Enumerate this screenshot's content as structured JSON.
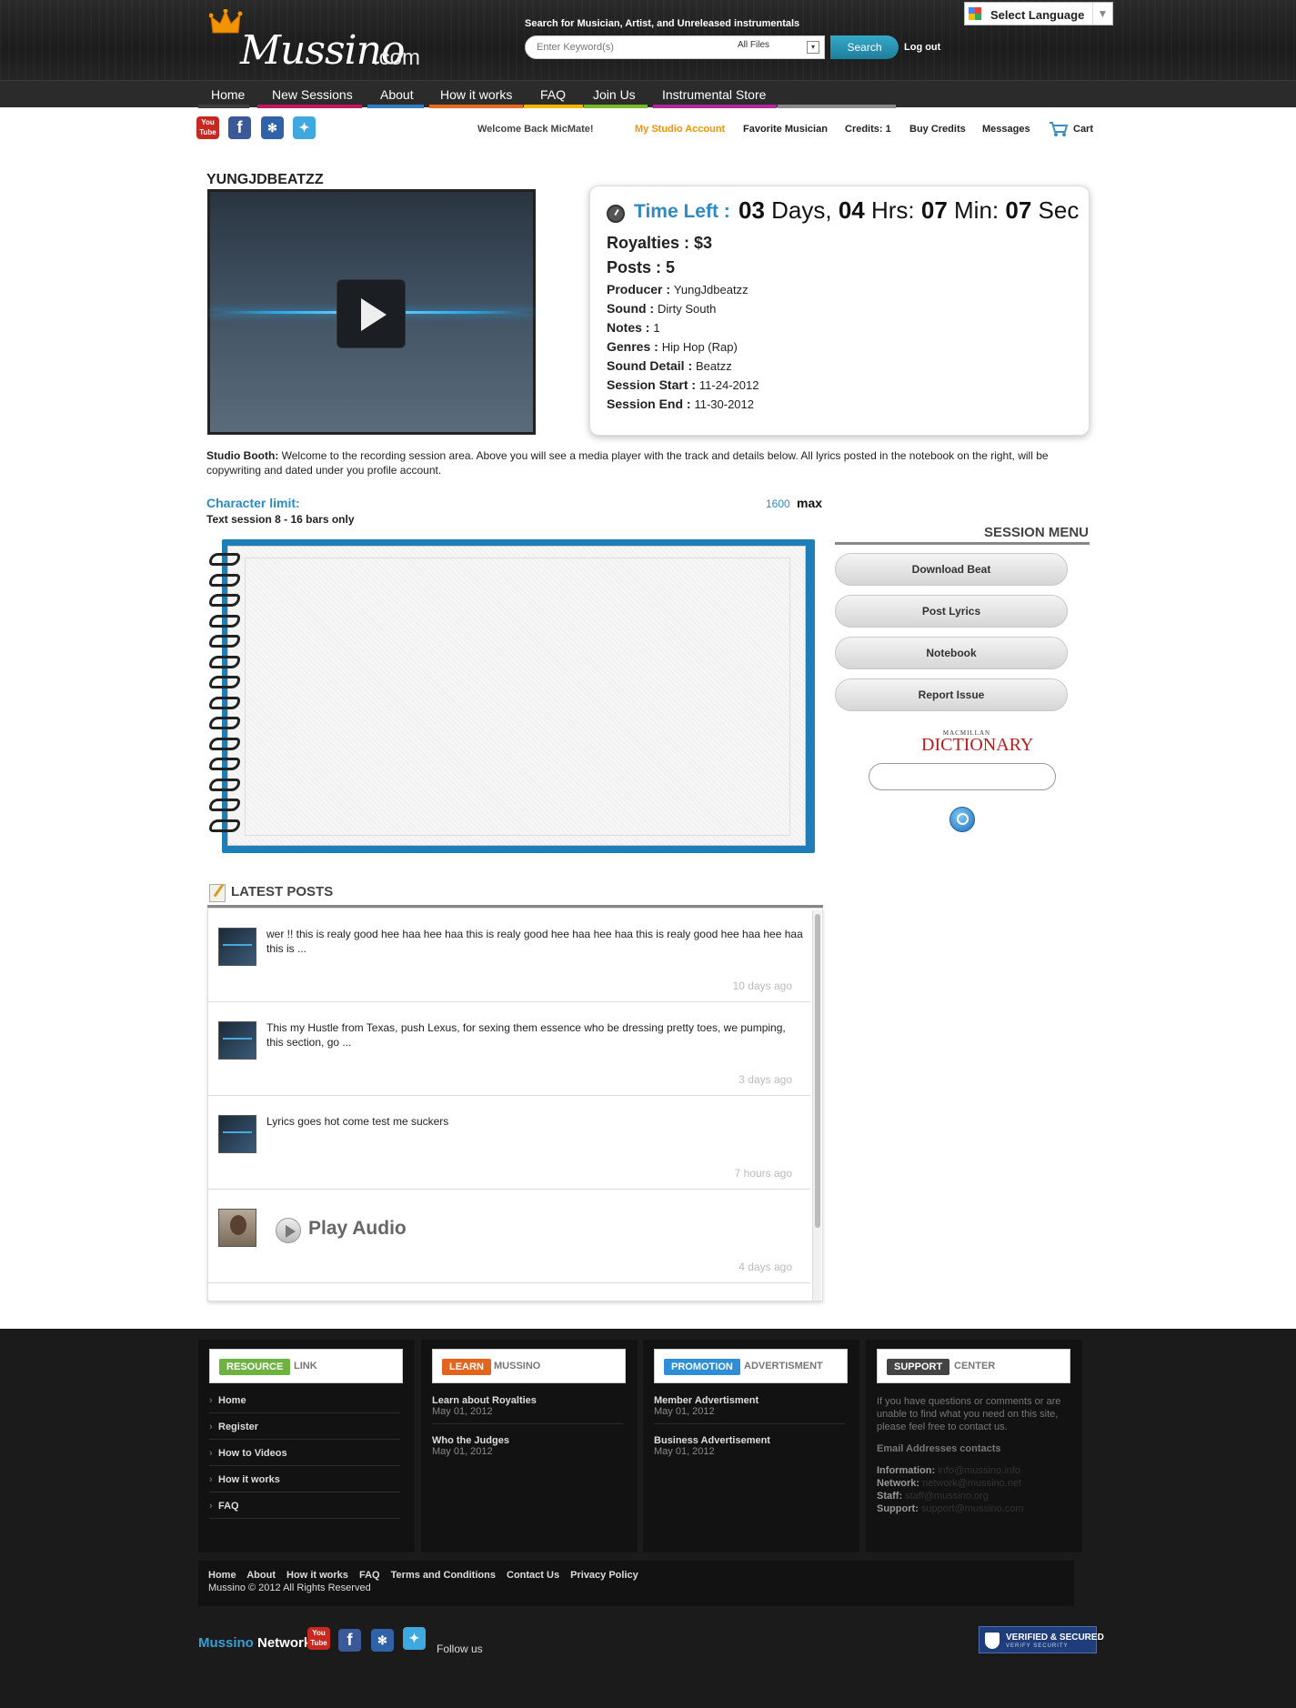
{
  "header": {
    "logo_text": "Mussino",
    "logo_domain": ".com",
    "search_caption": "Search for Musician, Artist, and Unreleased instrumentals",
    "search_placeholder": "Enter Keyword(s)",
    "search_scope": "All Files",
    "search_button": "Search",
    "logout": "Log out",
    "language_label": "Select Language"
  },
  "nav": {
    "items": [
      {
        "label": "Home",
        "color": "#3f3f3f"
      },
      {
        "label": "New Sessions",
        "color": "#c2185b"
      },
      {
        "label": "About",
        "color": "#2f7fc1"
      },
      {
        "label": "How it works",
        "color": "#e86a1c"
      },
      {
        "label": "FAQ",
        "color": "#f2b705"
      },
      {
        "label": "Join Us",
        "color": "#7ab828"
      },
      {
        "label": "Instrumental Store",
        "color": "#b5289b"
      }
    ]
  },
  "social_icons": [
    "youtube-icon",
    "facebook-icon",
    "myspace-icon",
    "twitter-icon"
  ],
  "userbar": {
    "welcome": "Welcome Back MicMate!",
    "studio": "My Studio Account",
    "favorite": "Favorite Musician",
    "credits": "Credits: 1",
    "buy": "Buy Credits",
    "messages": "Messages",
    "cart": "Cart"
  },
  "session": {
    "artist": "YUNGJDBEATZZ",
    "time_left_label": "Time Left :",
    "days": "03",
    "days_unit": " Days, ",
    "hrs": "04",
    "hrs_unit": " Hrs: ",
    "min": "07",
    "min_unit": " Min: ",
    "sec": "07",
    "sec_unit": " Sec",
    "royalties_label": "Royalties :",
    "royalties_value": "$3",
    "posts_label": "Posts :",
    "posts_value": "5",
    "details": [
      {
        "label": "Producer :",
        "value": "YungJdbeatzz"
      },
      {
        "label": "Sound :",
        "value": "Dirty South"
      },
      {
        "label": "Notes :",
        "value": "1"
      },
      {
        "label": "Genres :",
        "value": "Hip Hop (Rap)"
      },
      {
        "label": "Sound Detail :",
        "value": "Beatzz"
      },
      {
        "label": "Session Start :",
        "value": "11-24-2012"
      },
      {
        "label": "Session End :",
        "value": "11-30-2012"
      }
    ]
  },
  "booth": {
    "label": "Studio Booth:",
    "text": " Welcome to the recording session area. Above you will see a media player with the track and details below. All lyrics posted in the notebook on the right, will be copywriting and dated under you profile account."
  },
  "limits": {
    "char_limit_label": "Character limit:",
    "text_session": "Text session 8 - 16 bars only",
    "limit_value": "1600",
    "max_label": "max"
  },
  "session_menu": {
    "title": "SESSION MENU",
    "buttons": [
      "Download Beat",
      "Post Lyrics",
      "Notebook",
      "Report Issue"
    ],
    "dictionary_small": "MACMILLAN",
    "dictionary_big": "DICTIONARY"
  },
  "latest_posts": {
    "title": "LATEST POSTS",
    "items": [
      {
        "text": "wer !! this is realy good hee haa hee haa this is realy good hee haa hee haa this is realy good hee haa hee haa this is ...",
        "time": "10 days ago"
      },
      {
        "text": "This my Hustle from Texas, push Lexus, for sexing them essence who be dressing pretty toes, we pumping, this section, go ...",
        "time": "3 days ago"
      },
      {
        "text": "Lyrics goes hot come test me suckers",
        "time": "7 hours ago"
      },
      {
        "audio_label": "Play Audio",
        "time": "4 days ago"
      }
    ]
  },
  "footer": {
    "columns": [
      {
        "tag": "RESOURCE",
        "rest": "LINK",
        "tag_color": "#6cb33f",
        "links": [
          "Home",
          "Register",
          "How to Videos",
          "How it works",
          "FAQ"
        ]
      },
      {
        "tag": "LEARN",
        "rest": "MUSSINO",
        "tag_color": "#e2641d",
        "articles": [
          {
            "title": "Learn about Royalties",
            "date": "May 01, 2012"
          },
          {
            "title": "Who the Judges",
            "date": "May 01, 2012"
          }
        ]
      },
      {
        "tag": "PROMOTION",
        "rest": "ADVERTISMENT",
        "tag_color": "#2f8fd6",
        "articles": [
          {
            "title": "Member Advertisment",
            "date": "May 01, 2012"
          },
          {
            "title": "Business Advertisement",
            "date": "May 01, 2012"
          }
        ]
      },
      {
        "tag": "SUPPORT",
        "rest": "CENTER",
        "tag_color": "#444444",
        "text": "If you have questions or comments or are unable to find what you need on this site, please feel free to contact us.",
        "email_heading": "Email Addresses contacts",
        "contacts": [
          {
            "label": "Information:",
            "email": "info@mussino.info"
          },
          {
            "label": "Network:",
            "email": "network@mussino.net"
          },
          {
            "label": "Staff:",
            "email": "staff@mussino.org"
          },
          {
            "label": "Support:",
            "email": "support@mussino.com"
          }
        ]
      }
    ],
    "bottom_links": [
      "Home",
      "About",
      "How it works",
      "FAQ",
      "Terms and Conditions",
      "Contact Us",
      "Privacy Policy"
    ],
    "copyright": "Mussino © 2012 All Rights Reserved",
    "network_brand": "Mussino",
    "network_word": " Network",
    "follow": "Follow us",
    "verified_title": "VERIFIED & SECURED",
    "verified_sub": "VERIFY SECURITY"
  }
}
